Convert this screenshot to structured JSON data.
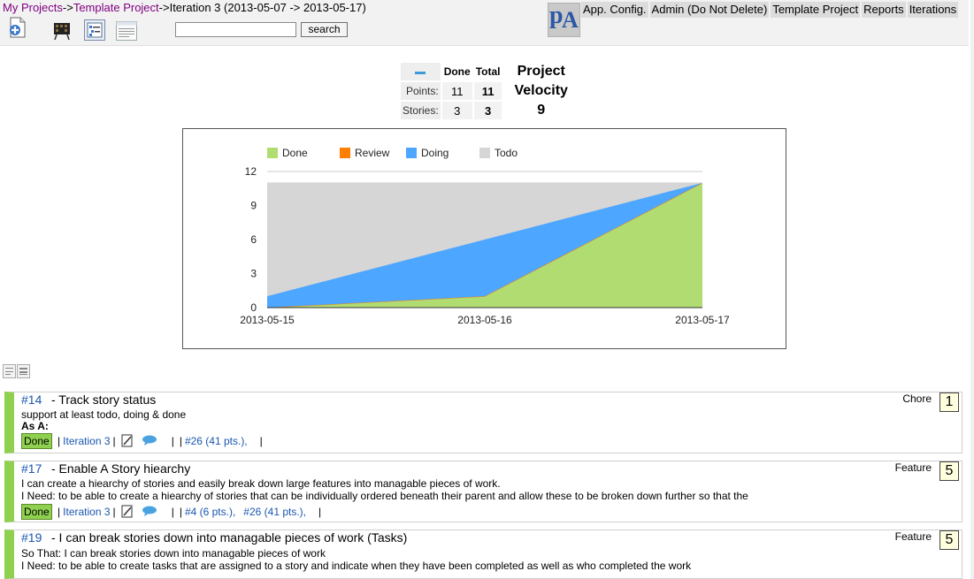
{
  "breadcrumb": {
    "my_projects": "My Projects",
    "sep1": "->",
    "project": "Template Project",
    "sep2": "->",
    "current": "Iteration 3 (2013-05-07 -> 2013-05-17)"
  },
  "toolbar": {
    "search_value": "",
    "search_button": "search",
    "icons": [
      "add-story-icon",
      "board-icon",
      "list-view-icon",
      "details-view-icon"
    ]
  },
  "logo": {
    "text_p": "p",
    "text_a": "A"
  },
  "nav": [
    "App. Config.",
    "Admin (Do Not Delete)",
    "Template Project",
    "Reports",
    "Iterations"
  ],
  "velocity": {
    "col_done": "Done",
    "col_total": "Total",
    "row_points": "Points:",
    "row_stories": "Stories:",
    "points_done": "11",
    "points_total": "11",
    "stories_done": "3",
    "stories_total": "3",
    "project_label_1": "Project",
    "project_label_2": "Velocity",
    "project_velocity": "9"
  },
  "chart_data": {
    "type": "area",
    "x": [
      "2013-05-15",
      "2013-05-16",
      "2013-05-17"
    ],
    "ylim": [
      0,
      12
    ],
    "yticks": [
      0,
      3,
      6,
      9,
      12
    ],
    "legend_position": "top-left",
    "grid": true,
    "series": [
      {
        "name": "Done",
        "color": "#b1dc72",
        "values": [
          0,
          1,
          11
        ]
      },
      {
        "name": "Review",
        "color": "#ff8000",
        "values": [
          0,
          0,
          0
        ]
      },
      {
        "name": "Doing",
        "color": "#4da6ff",
        "values": [
          1,
          5,
          0
        ]
      },
      {
        "name": "Todo",
        "color": "#d6d6d6",
        "values": [
          10,
          5,
          0
        ]
      }
    ]
  },
  "stories": [
    {
      "id": "#14",
      "title": "- Track story status",
      "lines": [
        "support at least todo, doing & done",
        "As A:"
      ],
      "type": "Chore",
      "points": "1",
      "status": "Done",
      "iteration": "Iteration 3",
      "links": "#26 (41 pts.),"
    },
    {
      "id": "#17",
      "title": "- Enable A Story hiearchy",
      "lines": [
        "I can create a hiearchy of stories and easily break down large features into managable pieces of work.",
        "I Need: to be able to create a hiearchy of stories that can be individually ordered beneath their parent and allow these to be broken down further so that the"
      ],
      "type": "Feature",
      "points": "5",
      "status": "Done",
      "iteration": "Iteration 3",
      "links": "#4 (6 pts.),",
      "links2": "#26 (41 pts.),"
    },
    {
      "id": "#19",
      "title": "- I can break stories down into managable pieces of work (Tasks)",
      "lines": [
        "So That: I can break stories down into managable pieces of work",
        "I Need: to be able to create tasks that are assigned to a story and indicate when they have been completed as well as who completed the work"
      ],
      "type": "Feature",
      "points": "5"
    }
  ],
  "colors": {
    "done_badge": "#8fd14f",
    "link": "#1a56b0",
    "visited": "#800080"
  }
}
